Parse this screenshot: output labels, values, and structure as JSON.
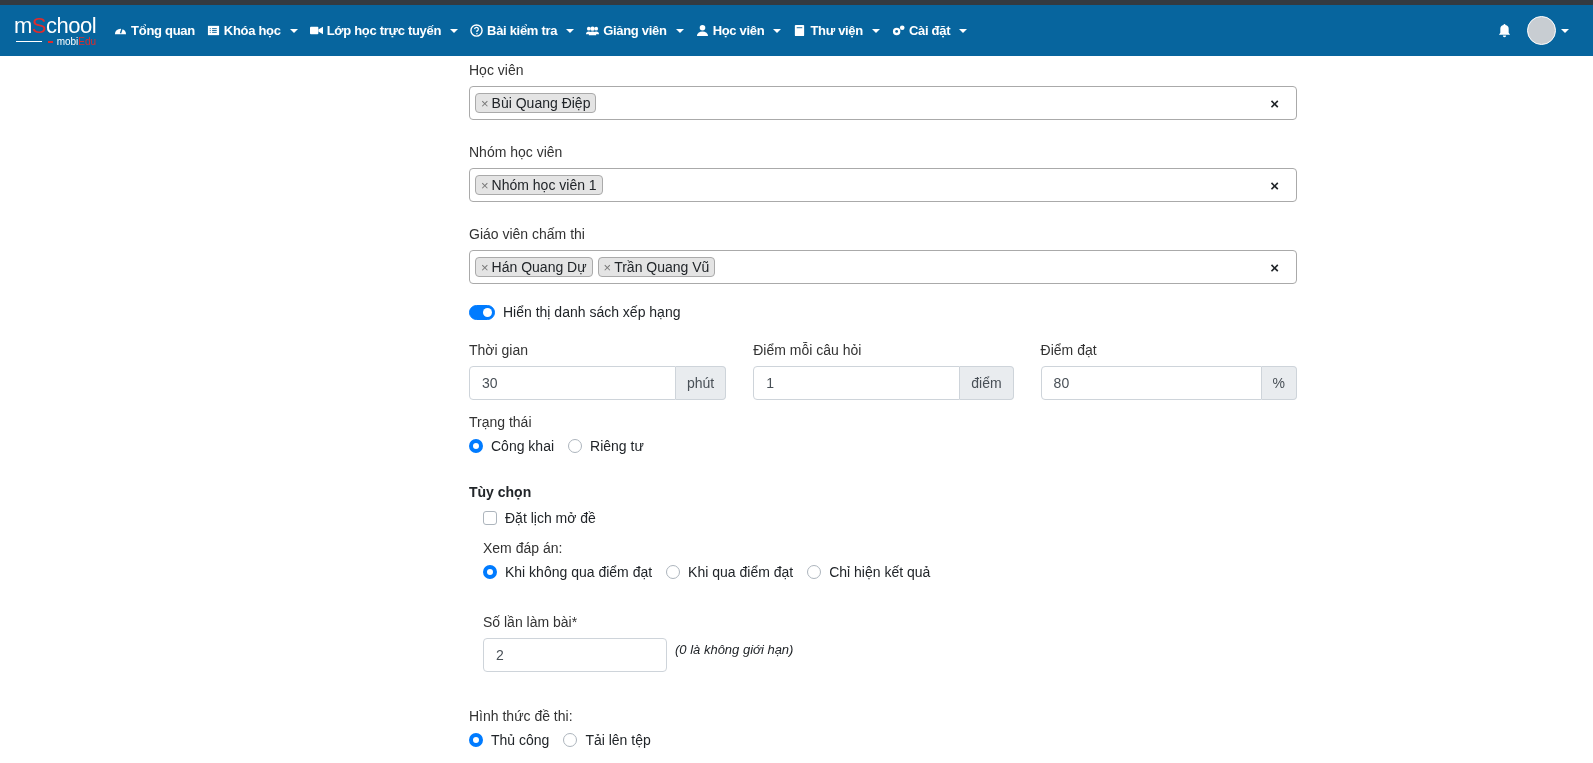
{
  "navbar": {
    "logo": {
      "main": [
        {
          "text": "m",
          "accent": false
        },
        {
          "text": "S",
          "accent": true
        },
        {
          "text": "chool",
          "accent": false
        }
      ],
      "sub": [
        {
          "text": "mobi",
          "accent": false
        },
        {
          "text": "Edu",
          "accent": true
        }
      ]
    },
    "items": [
      {
        "label": "Tổng quan",
        "dropdown": false
      },
      {
        "label": "Khóa học",
        "dropdown": true
      },
      {
        "label": "Lớp học trực tuyến",
        "dropdown": true
      },
      {
        "label": "Bài kiểm tra",
        "dropdown": true
      },
      {
        "label": "Giảng viên",
        "dropdown": true
      },
      {
        "label": "Học viên",
        "dropdown": true
      },
      {
        "label": "Thư viện",
        "dropdown": true
      },
      {
        "label": "Cài đặt",
        "dropdown": true
      }
    ],
    "user_menu": {
      "dropdown": true
    }
  },
  "tag_fields": [
    {
      "label": "Học viên",
      "tags": [
        {
          "label": "Bùi Quang Điệp",
          "remove": "×"
        }
      ],
      "clear": "×"
    },
    {
      "label": "Nhóm học viên",
      "tags": [
        {
          "label": "Nhóm học viên 1",
          "remove": "×"
        }
      ],
      "clear": "×"
    },
    {
      "label": "Giáo viên chấm thi",
      "tags": [
        {
          "label": "Hán Quang Dự",
          "remove": "×"
        },
        {
          "label": "Trần Quang Vũ",
          "remove": "×"
        }
      ],
      "clear": "×"
    }
  ],
  "ranking_toggle": {
    "label": "Hiển thị danh sách xếp hạng",
    "on": true
  },
  "number_fields": [
    {
      "label": "Thời gian",
      "value": "30",
      "unit": "phút"
    },
    {
      "label": "Điểm mỗi câu hỏi",
      "value": "1",
      "unit": "điểm"
    },
    {
      "label": "Điểm đạt",
      "value": "80",
      "unit": "%"
    }
  ],
  "status": {
    "label": "Trạng thái",
    "options": [
      {
        "label": "Công khai",
        "selected": true
      },
      {
        "label": "Riêng tư",
        "selected": false
      }
    ]
  },
  "options": {
    "title": "Tùy chọn",
    "schedule": {
      "label": "Đặt lịch mở đề",
      "checked": false
    },
    "view_answers": {
      "label": "Xem đáp án:",
      "options": [
        {
          "label": "Khi không qua điểm đạt",
          "selected": true
        },
        {
          "label": "Khi qua điểm đạt",
          "selected": false
        },
        {
          "label": "Chỉ hiện kết quả",
          "selected": false
        }
      ]
    },
    "attempts": {
      "label": "Số lần làm bài*",
      "value": "2",
      "hint": "(0 là không giới hạn)"
    }
  },
  "exam_format": {
    "label": "Hình thức đề thi:",
    "options": [
      {
        "label": "Thủ công",
        "selected": true
      },
      {
        "label": "Tải lên tệp",
        "selected": false
      }
    ]
  }
}
